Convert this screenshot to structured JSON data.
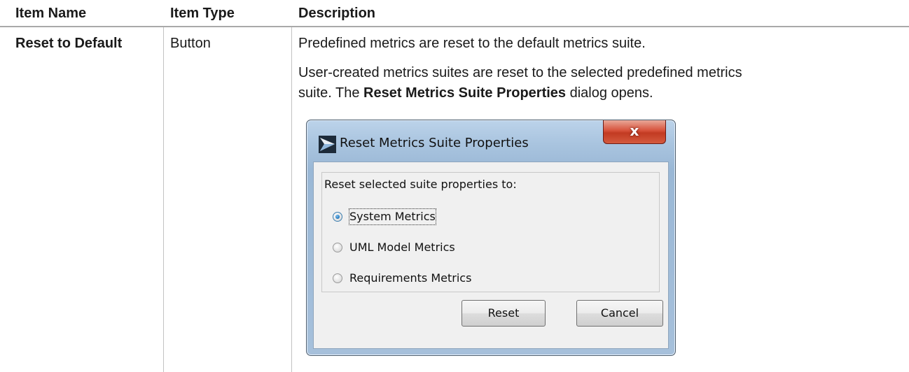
{
  "table": {
    "headers": {
      "name": "Item Name",
      "type": "Item Type",
      "description": "Description"
    },
    "row": {
      "name": "Reset to Default",
      "type": "Button",
      "desc_line1": "Predefined metrics are reset to the default metrics suite.",
      "desc_line2": "User-created metrics suites are reset to the selected predefined metrics",
      "desc_line3_pre": "suite. The ",
      "desc_line3_bold": "Reset Metrics Suite Properties",
      "desc_line3_post": " dialog opens."
    }
  },
  "dialog": {
    "title": "Reset Metrics Suite Properties",
    "close_label": "x",
    "group_label": "Reset selected suite properties to:",
    "options": [
      {
        "label": "System Metrics",
        "selected": true
      },
      {
        "label": "UML Model Metrics",
        "selected": false
      },
      {
        "label": "Requirements Metrics",
        "selected": false
      }
    ],
    "reset_label": "Reset",
    "cancel_label": "Cancel",
    "icon": "magicdraw-app-icon",
    "colors": {
      "frame": "#a9c4df",
      "close_button": "#c23a22",
      "radio_selected": "#1f73b6"
    }
  }
}
